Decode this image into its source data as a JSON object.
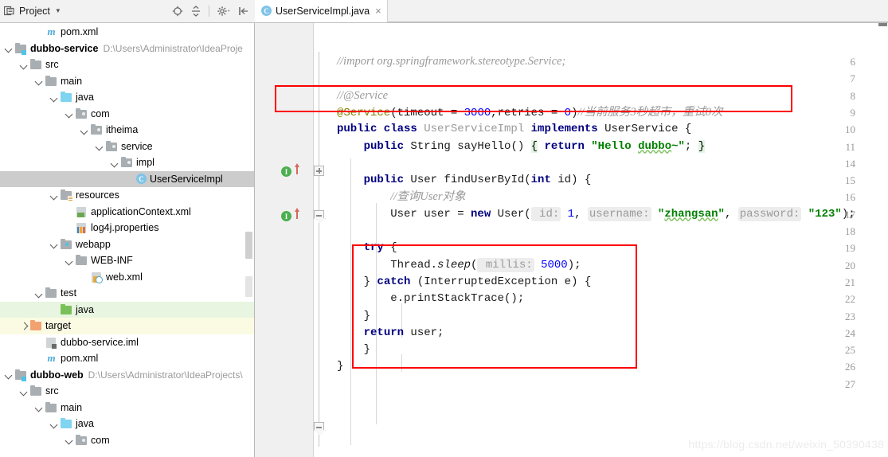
{
  "window": {
    "project_panel_title": "Project",
    "toolbar_icons": [
      "locate-target-icon",
      "collapse-all-icon",
      "settings-gear-icon",
      "hide-panel-icon"
    ]
  },
  "editor_tabs": [
    {
      "label": "UserServiceImpl.java",
      "badge": "C",
      "close": "×",
      "active": true
    }
  ],
  "tree": [
    {
      "indent": 2,
      "arrow": "none",
      "icon": "maven-file-icon",
      "label": "pom.xml",
      "path": "",
      "state": ""
    },
    {
      "indent": 0,
      "arrow": "down",
      "icon": "module-folder-icon",
      "label": "dubbo-service",
      "path": "D:\\Users\\Administrator\\IdeaProje",
      "state": "bold"
    },
    {
      "indent": 1,
      "arrow": "down",
      "icon": "folder-icon",
      "label": "src",
      "path": "",
      "state": ""
    },
    {
      "indent": 2,
      "arrow": "down",
      "icon": "folder-icon",
      "label": "main",
      "path": "",
      "state": ""
    },
    {
      "indent": 3,
      "arrow": "down",
      "icon": "source-folder-icon",
      "label": "java",
      "path": "",
      "state": ""
    },
    {
      "indent": 4,
      "arrow": "down",
      "icon": "package-icon",
      "label": "com",
      "path": "",
      "state": ""
    },
    {
      "indent": 5,
      "arrow": "down",
      "icon": "package-icon",
      "label": "itheima",
      "path": "",
      "state": ""
    },
    {
      "indent": 6,
      "arrow": "down",
      "icon": "package-icon",
      "label": "service",
      "path": "",
      "state": ""
    },
    {
      "indent": 7,
      "arrow": "down",
      "icon": "package-icon",
      "label": "impl",
      "path": "",
      "state": ""
    },
    {
      "indent": 8,
      "arrow": "none",
      "icon": "java-class-icon",
      "label": "UserServiceImpl",
      "path": "",
      "state": "selected"
    },
    {
      "indent": 3,
      "arrow": "down",
      "icon": "resources-folder-icon",
      "label": "resources",
      "path": "",
      "state": ""
    },
    {
      "indent": 4,
      "arrow": "none",
      "icon": "spring-xml-icon",
      "label": "applicationContext.xml",
      "path": "",
      "state": ""
    },
    {
      "indent": 4,
      "arrow": "none",
      "icon": "properties-file-icon",
      "label": "log4j.properties",
      "path": "",
      "state": ""
    },
    {
      "indent": 3,
      "arrow": "down",
      "icon": "webapp-folder-icon",
      "label": "webapp",
      "path": "",
      "state": ""
    },
    {
      "indent": 4,
      "arrow": "down",
      "icon": "folder-icon",
      "label": "WEB-INF",
      "path": "",
      "state": ""
    },
    {
      "indent": 5,
      "arrow": "none",
      "icon": "web-xml-icon",
      "label": "web.xml",
      "path": "",
      "state": ""
    },
    {
      "indent": 2,
      "arrow": "down",
      "icon": "folder-icon",
      "label": "test",
      "path": "",
      "state": ""
    },
    {
      "indent": 3,
      "arrow": "none",
      "icon": "test-source-folder-icon",
      "label": "java",
      "path": "",
      "state": "highlight-green"
    },
    {
      "indent": 1,
      "arrow": "right",
      "icon": "excluded-folder-icon",
      "label": "target",
      "path": "",
      "state": "highlight-yellow"
    },
    {
      "indent": 2,
      "arrow": "none",
      "icon": "iml-file-icon",
      "label": "dubbo-service.iml",
      "path": "",
      "state": ""
    },
    {
      "indent": 2,
      "arrow": "none",
      "icon": "maven-file-icon",
      "label": "pom.xml",
      "path": "",
      "state": ""
    },
    {
      "indent": 0,
      "arrow": "down",
      "icon": "module-folder-icon",
      "label": "dubbo-web",
      "path": "D:\\Users\\Administrator\\IdeaProjects\\",
      "state": "bold"
    },
    {
      "indent": 1,
      "arrow": "down",
      "icon": "folder-icon",
      "label": "src",
      "path": "",
      "state": ""
    },
    {
      "indent": 2,
      "arrow": "down",
      "icon": "folder-icon",
      "label": "main",
      "path": "",
      "state": ""
    },
    {
      "indent": 3,
      "arrow": "down",
      "icon": "source-folder-icon",
      "label": "java",
      "path": "",
      "state": ""
    },
    {
      "indent": 4,
      "arrow": "down",
      "icon": "package-icon",
      "label": "com",
      "path": "",
      "state": ""
    }
  ],
  "code": {
    "line_numbers": [
      "6",
      "7",
      "8",
      "9",
      "10",
      "11",
      "14",
      "15",
      "16",
      "17",
      "18",
      "19",
      "20",
      "21",
      "22",
      "23",
      "24",
      "25",
      "26",
      "27"
    ],
    "lines": [
      {
        "n": "6",
        "text": "//import org.springframework.stereotype.Service;"
      },
      {
        "n": "7",
        "text": ""
      },
      {
        "n": "8",
        "text": "//@Service"
      },
      {
        "n": "9",
        "text": "@Service(timeout = 3000,retries = 0)//当前服务3秒超市，重试0次"
      },
      {
        "n": "10",
        "text": "public class UserServiceImpl implements UserService {"
      },
      {
        "n": "11",
        "text": "    public String sayHello() { return \"Hello dubbo~\"; }"
      },
      {
        "n": "14",
        "text": ""
      },
      {
        "n": "15",
        "text": "    public User findUserById(int id) {"
      },
      {
        "n": "16",
        "text": "        //查询User对象"
      },
      {
        "n": "17",
        "text": "        User user = new User( id: 1, username: \"zhangsan\", password: \"123\");"
      },
      {
        "n": "18",
        "text": ""
      },
      {
        "n": "19",
        "text": "        try {"
      },
      {
        "n": "20",
        "text": "            Thread.sleep( millis: 5000);"
      },
      {
        "n": "21",
        "text": "        } catch (InterruptedException e) {"
      },
      {
        "n": "22",
        "text": "            e.printStackTrace();"
      },
      {
        "n": "23",
        "text": "        }"
      },
      {
        "n": "24",
        "text": "        return user;"
      },
      {
        "n": "25",
        "text": "    }"
      },
      {
        "n": "26",
        "text": "}"
      },
      {
        "n": "27",
        "text": ""
      }
    ],
    "gutter_markers": [
      {
        "line": "11",
        "icon": "implementing-method-icon",
        "glyph": "I"
      },
      {
        "line": "15",
        "icon": "implementing-method-icon",
        "glyph": "I"
      }
    ],
    "annotations": [
      {
        "name": "service-annotation-highlight",
        "target_line": "9"
      },
      {
        "name": "try-catch-block-highlight",
        "target_lines": "19-23"
      }
    ]
  },
  "watermark": "https://blog.csdn.net/weixin_50390438",
  "colors": {
    "keyword": "#000080",
    "string": "#008000",
    "number": "#0000ff",
    "annotation": "#808000",
    "comment": "#9a9a9a",
    "highlight_red": "#ff0000",
    "selection": "#cccccc"
  }
}
